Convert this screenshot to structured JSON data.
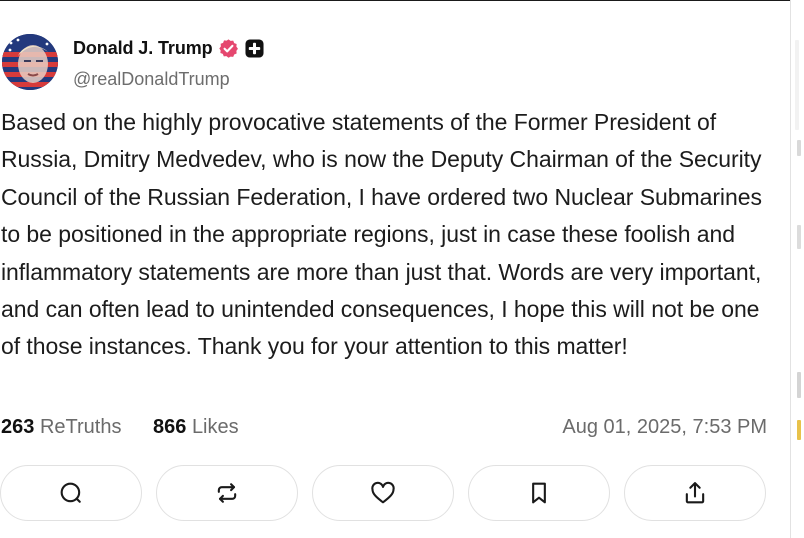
{
  "post": {
    "author": {
      "display_name": "Donald J. Trump",
      "handle": "@realDonaldTrump",
      "verified_badge_icon": "verified-icon",
      "plus_badge_icon": "plus-badge-icon"
    },
    "text": "Based on the highly provocative statements of the Former President of Russia, Dmitry Medvedev, who is now the Deputy Chairman of the Security Council of the Russian Federation, I have ordered two Nuclear Submarines to be positioned in the appropriate regions, just in case these foolish and inflammatory statements are more than just that. Words are very important, and can often lead to unintended consequences, I hope this will not be one of those instances. Thank you for your attention to this matter!",
    "stats": {
      "retruths_count": "263",
      "retruths_label": "ReTruths",
      "likes_count": "866",
      "likes_label": "Likes"
    },
    "timestamp": "Aug 01, 2025, 7:53 PM"
  },
  "actions": [
    {
      "name": "reply",
      "icon": "comment-icon"
    },
    {
      "name": "retruth",
      "icon": "repost-icon"
    },
    {
      "name": "like",
      "icon": "heart-icon"
    },
    {
      "name": "bookmark",
      "icon": "bookmark-icon"
    },
    {
      "name": "share",
      "icon": "share-icon"
    }
  ],
  "colors": {
    "text": "#1c1c1c",
    "muted": "#6b6b6b",
    "verified": "#e5476f",
    "button_border": "#e1e1e1"
  }
}
